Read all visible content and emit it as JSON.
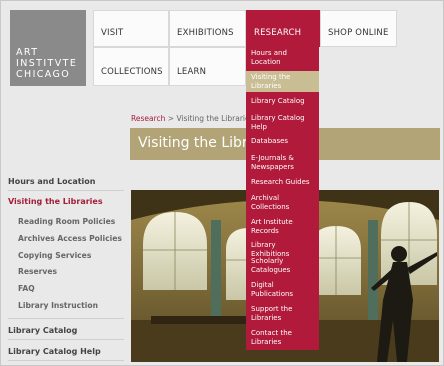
{
  "logo": {
    "line1": "ART",
    "line2": "INSTITVTE",
    "line3": "CHICAGO"
  },
  "nav": {
    "visit": "VISIT",
    "exhibitions": "EXHIBITIONS",
    "research": "RESEARCH",
    "shop": "SHOP ONLINE",
    "collections": "COLLECTIONS",
    "learn": "LEARN"
  },
  "breadcrumb": {
    "root": "Research",
    "separator": " > ",
    "current": "Visiting the Libraries"
  },
  "page_title": "Visiting the Libraries",
  "sidebar": {
    "hours": "Hours and Location",
    "visiting": "Visiting the Libraries",
    "reading_room": "Reading Room Policies",
    "archives_access": "Archives Access Policies",
    "copying": "Copying Services",
    "reserves": "Reserves",
    "faq": "FAQ",
    "instruction": "Library Instruction",
    "catalog": "Library Catalog",
    "catalog_help": "Library Catalog Help"
  },
  "dropdown": {
    "items": [
      "Hours and Location",
      "Visiting the Libraries",
      "Library Catalog",
      "Library Catalog Help",
      "Databases",
      "E-Journals & Newspapers",
      "Research Guides",
      "Archival Collections",
      "Art Institute Records",
      "Library Exhibitions",
      "Scholarly Catalogues",
      "Digital Publications",
      "Support the Libraries",
      "Contact the Libraries"
    ]
  },
  "colors": {
    "brand_red": "#b11a3a",
    "title_bar": "#b2a477",
    "selected_item": "#c9bd93"
  }
}
